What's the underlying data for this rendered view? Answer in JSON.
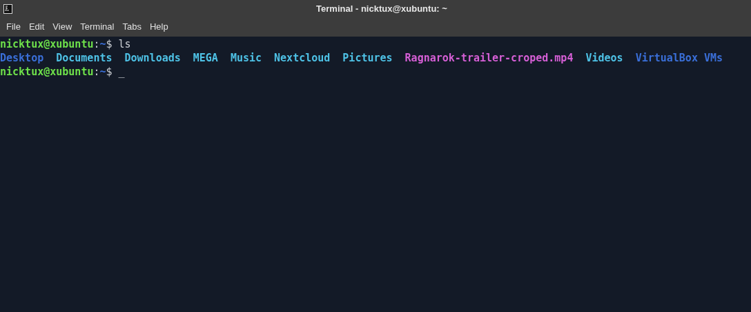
{
  "window": {
    "title": "Terminal - nicktux@xubuntu: ~"
  },
  "menu": [
    "File",
    "Edit",
    "View",
    "Terminal",
    "Tabs",
    "Help"
  ],
  "lines": [
    {
      "kind": "prompt",
      "user_host": "nicktux@xubuntu",
      "separator": ":",
      "path": "~",
      "symbol": "$",
      "command": "ls"
    },
    {
      "kind": "listing",
      "entries": [
        {
          "name": "Desktop",
          "color": "#3a6fd8"
        },
        {
          "name": "Documents",
          "color": "#4ec2e6"
        },
        {
          "name": "Downloads",
          "color": "#4ec2e6"
        },
        {
          "name": "MEGA",
          "color": "#4ec2e6"
        },
        {
          "name": "Music",
          "color": "#4ec2e6"
        },
        {
          "name": "Nextcloud",
          "color": "#4ec2e6"
        },
        {
          "name": "Pictures",
          "color": "#4ec2e6"
        },
        {
          "name": "Ragnarok-trailer-croped.mp4",
          "color": "#d65fd6"
        },
        {
          "name": "Videos",
          "color": "#4ec2e6"
        },
        {
          "name": "VirtualBox VMs",
          "color": "#3a6fd8"
        }
      ]
    },
    {
      "kind": "prompt",
      "user_host": "nicktux@xubuntu",
      "separator": ":",
      "path": "~",
      "symbol": "$",
      "cursor": "_"
    }
  ]
}
